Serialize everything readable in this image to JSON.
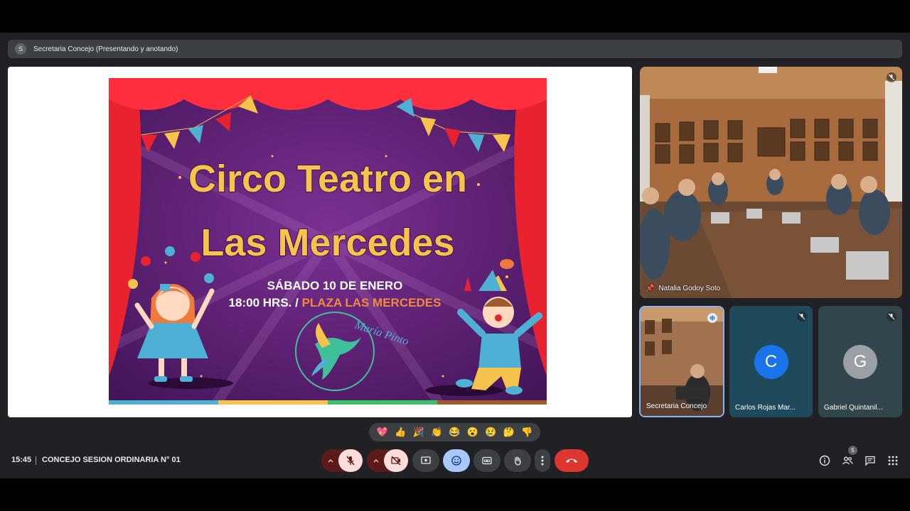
{
  "presentation_bar": {
    "avatar_letter": "S",
    "label": "Secretaria Concejo (Presentando y anotando)"
  },
  "slide": {
    "title_line1": "Circo Teatro en",
    "title_line2": "Las Mercedes",
    "date_line": "SÁBADO 10 DE ENERO",
    "time": "18:00 HRS.",
    "separator": " / ",
    "place": "PLAZA LAS MERCEDES",
    "logo_text": "María Pinto",
    "colors": {
      "background": "#5a1f6e",
      "curtain": "#e8232f",
      "title": "#f6c34c",
      "place": "#f08a3c"
    }
  },
  "participants": {
    "main": {
      "name": "Natalia Godoy Soto",
      "pin_icon": "pin-icon",
      "mic_icon": "mic-off-icon"
    },
    "secretaria": {
      "name": "Secretaria Concejo",
      "audio_icon": "speaking-icon"
    },
    "carlos": {
      "letter": "C",
      "name": "Carlos Rojas Mar...",
      "color": "#1a73e8"
    },
    "gabriel": {
      "letter": "G",
      "name": "Gabriel Quintanil...",
      "color": "#9aa0a6"
    }
  },
  "reactions": [
    "💖",
    "👍",
    "🎉",
    "👏",
    "😂",
    "😮",
    "😢",
    "🤔",
    "👎"
  ],
  "bottom_bar": {
    "time": "15:45",
    "meeting_title": "CONCEJO SESION ORDINARIA N° 01",
    "participant_count": "5"
  }
}
